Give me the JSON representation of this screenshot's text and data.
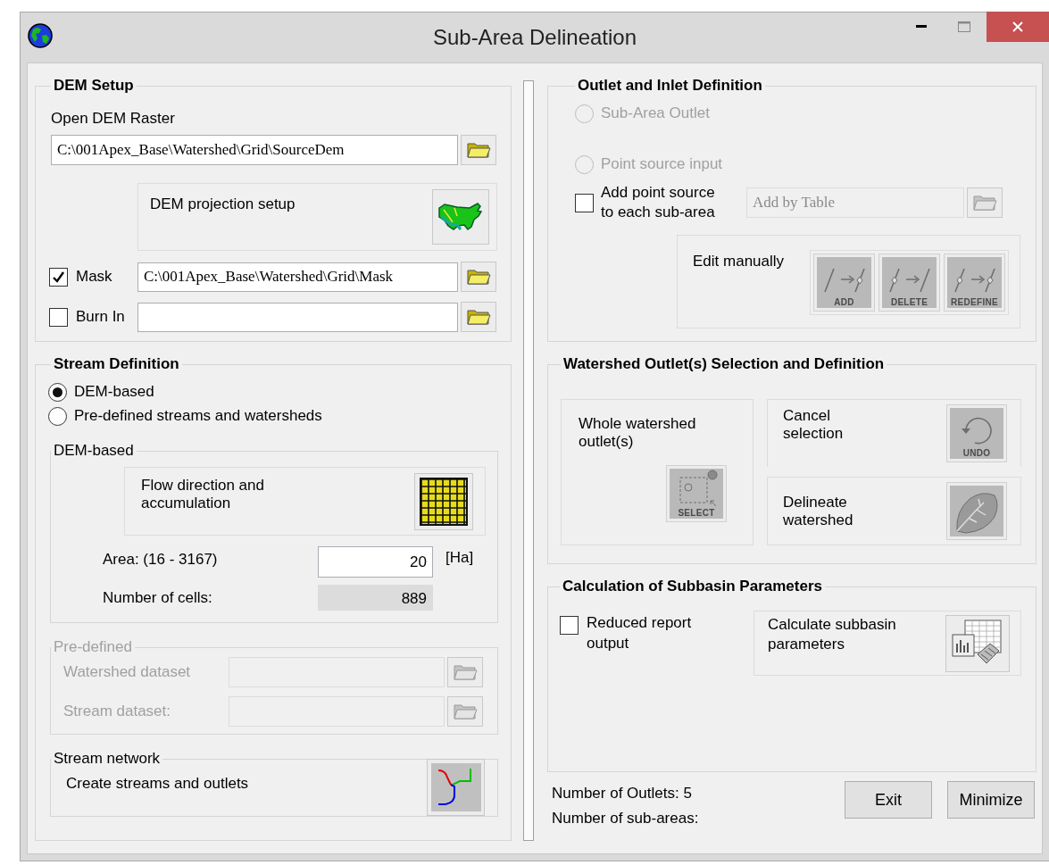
{
  "window": {
    "title": "Sub-Area Delineation"
  },
  "dem_setup": {
    "title": "DEM Setup",
    "raster_label": "Open DEM Raster",
    "raster_path": "C:\\001Apex_Base\\Watershed\\Grid\\SourceDem",
    "projection_label": "DEM projection setup",
    "mask": {
      "label": "Mask",
      "checked": true,
      "value": "C:\\001Apex_Base\\Watershed\\Grid\\Mask"
    },
    "burn_in": {
      "label": "Burn In",
      "checked": false
    }
  },
  "stream_definition": {
    "title": "Stream Definition",
    "options": [
      {
        "label": "DEM-based",
        "selected": true
      },
      {
        "label": "Pre-defined streams and watersheds",
        "selected": false
      }
    ],
    "dem_based": {
      "title": "DEM-based",
      "flow_label": "Flow direction and accumulation",
      "area_label": "Area: (16 - 3167)",
      "area_value": "20",
      "area_unit": "[Ha]",
      "cells_label": "Number of cells:",
      "cells_value": "889"
    },
    "pre_defined": {
      "title": "Pre-defined",
      "disabled": true,
      "fields": [
        {
          "label": "Watershed dataset"
        },
        {
          "label": "Stream dataset:"
        }
      ]
    },
    "stream_network": {
      "title": "Stream network",
      "label": "Create streams and outlets"
    }
  },
  "outlet_inlet": {
    "title": "Outlet and Inlet Definition",
    "options": [
      {
        "label": "Sub-Area Outlet",
        "selected": false,
        "disabled": true
      },
      {
        "label": "Point source input",
        "selected": false,
        "disabled": true
      }
    ],
    "point_source": {
      "label": "Add point source to each sub-area",
      "checked": false,
      "value": "Add by Table",
      "disabled": true
    },
    "edit": {
      "label": "Edit manually",
      "tools": [
        {
          "kind": "add",
          "caption": "ADD",
          "disabled": true
        },
        {
          "kind": "delete",
          "caption": "DELETE",
          "disabled": true
        },
        {
          "kind": "redefine",
          "caption": "REDEFINE",
          "disabled": true
        }
      ]
    }
  },
  "watershed_outlets": {
    "title": "Watershed Outlet(s) Selection and Definition",
    "whole": {
      "label": "Whole watershed outlet(s)",
      "caption": "SELECT",
      "disabled": true
    },
    "cancel": {
      "label": "Cancel selection",
      "caption": "UNDO",
      "disabled": true
    },
    "delineate": {
      "label": "Delineate watershed",
      "disabled": true
    }
  },
  "subbasin": {
    "title": "Calculation of Subbasin Parameters",
    "reduced": {
      "label": "Reduced report output",
      "checked": false
    },
    "calculate": {
      "label": "Calculate subbasin parameters"
    }
  },
  "status": {
    "outlets": "Number of Outlets: 5",
    "subareas": "Number of sub-areas:"
  },
  "buttons": [
    {
      "label": "Exit"
    },
    {
      "label": "Minimize"
    }
  ]
}
